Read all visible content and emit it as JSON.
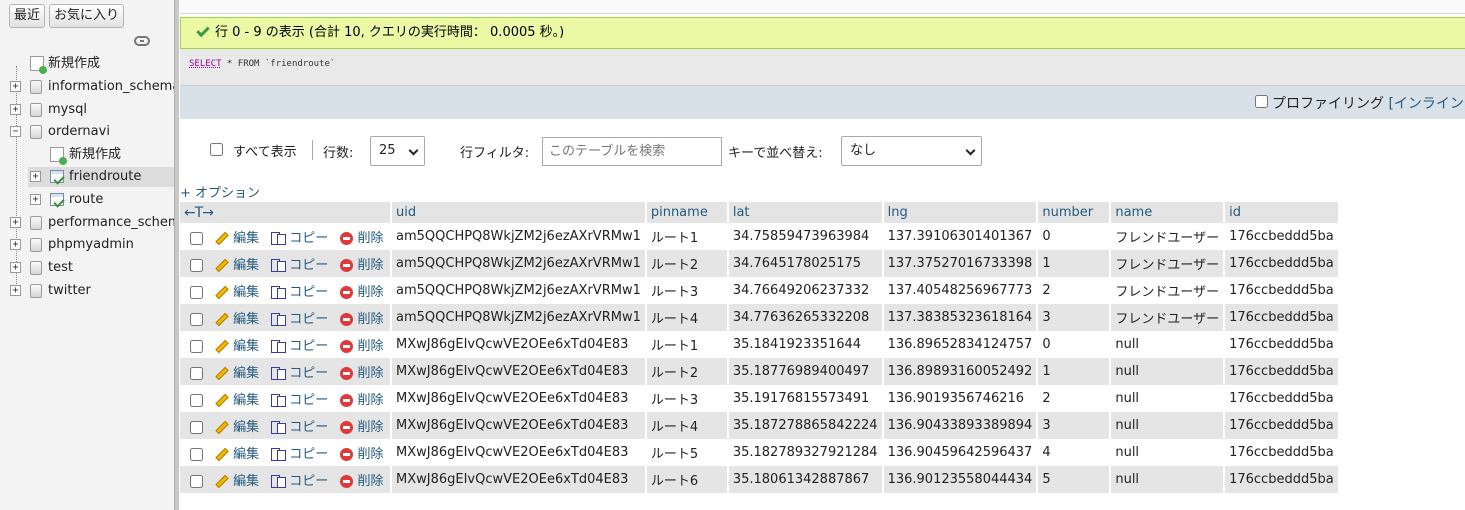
{
  "sidebar": {
    "tabs": {
      "recent": "最近",
      "favorites": "お気に入り"
    },
    "tree": [
      {
        "label": "新規作成",
        "type": "new"
      },
      {
        "label": "information_schema",
        "type": "db"
      },
      {
        "label": "mysql",
        "type": "db"
      },
      {
        "label": "ordernavi",
        "type": "db",
        "expanded": true
      },
      {
        "label": "新規作成",
        "type": "new-child"
      },
      {
        "label": "friendroute",
        "type": "table",
        "active": true
      },
      {
        "label": "route",
        "type": "table"
      },
      {
        "label": "performance_schema",
        "type": "db"
      },
      {
        "label": "phpmyadmin",
        "type": "db"
      },
      {
        "label": "test",
        "type": "db"
      },
      {
        "label": "twitter",
        "type": "db"
      }
    ]
  },
  "message": {
    "success": "行 0 - 9 の表示 (合計 10, クエリの実行時間： 0.0005 秒。)"
  },
  "sql": {
    "select": "SELECT",
    "rest": " * FROM `friendroute`"
  },
  "profiling": {
    "label": "プロファイリング ",
    "link": "[インラインを"
  },
  "controls": {
    "show_all": "すべて表示",
    "rows_label": "行数:",
    "rows_value": "25",
    "filter_label": "行フィルタ:",
    "filter_placeholder": "このテーブルを検索",
    "sort_label": "キーで並べ替え:",
    "sort_value": "なし",
    "options": "+ オプション"
  },
  "actions": {
    "edit": "編集",
    "copy": "コピー",
    "delete": "削除"
  },
  "table": {
    "arrows": "←T→",
    "columns": [
      "uid",
      "pinname",
      "lat",
      "lng",
      "number",
      "name",
      "id"
    ],
    "rows": [
      [
        "am5QQCHPQ8WkjZM2j6ezAXrVRMw1",
        "ルート1",
        "34.75859473963984",
        "137.39106301401367",
        "0",
        "フレンドユーザー",
        "176ccbeddd5ba"
      ],
      [
        "am5QQCHPQ8WkjZM2j6ezAXrVRMw1",
        "ルート2",
        "34.7645178025175",
        "137.37527016733398",
        "1",
        "フレンドユーザー",
        "176ccbeddd5ba"
      ],
      [
        "am5QQCHPQ8WkjZM2j6ezAXrVRMw1",
        "ルート3",
        "34.76649206237332",
        "137.40548256967773",
        "2",
        "フレンドユーザー",
        "176ccbeddd5ba"
      ],
      [
        "am5QQCHPQ8WkjZM2j6ezAXrVRMw1",
        "ルート4",
        "34.77636265332208",
        "137.38385323618164",
        "3",
        "フレンドユーザー",
        "176ccbeddd5ba"
      ],
      [
        "MXwJ86gEIvQcwVE2OEe6xTd04E83",
        "ルート1",
        "35.1841923351644",
        "136.89652834124757",
        "0",
        "null",
        "176ccbeddd5ba"
      ],
      [
        "MXwJ86gEIvQcwVE2OEe6xTd04E83",
        "ルート2",
        "35.18776989400497",
        "136.89893160052492",
        "1",
        "null",
        "176ccbeddd5ba"
      ],
      [
        "MXwJ86gEIvQcwVE2OEe6xTd04E83",
        "ルート3",
        "35.19176815573491",
        "136.9019356746216",
        "2",
        "null",
        "176ccbeddd5ba"
      ],
      [
        "MXwJ86gEIvQcwVE2OEe6xTd04E83",
        "ルート4",
        "35.187278865842224",
        "136.90433893389894",
        "3",
        "null",
        "176ccbeddd5ba"
      ],
      [
        "MXwJ86gEIvQcwVE2OEe6xTd04E83",
        "ルート5",
        "35.182789327921284",
        "136.90459642596437",
        "4",
        "null",
        "176ccbeddd5ba"
      ],
      [
        "MXwJ86gEIvQcwVE2OEe6xTd04E83",
        "ルート6",
        "35.18061342887867",
        "136.90123558044434",
        "5",
        "null",
        "176ccbeddd5ba"
      ]
    ]
  }
}
